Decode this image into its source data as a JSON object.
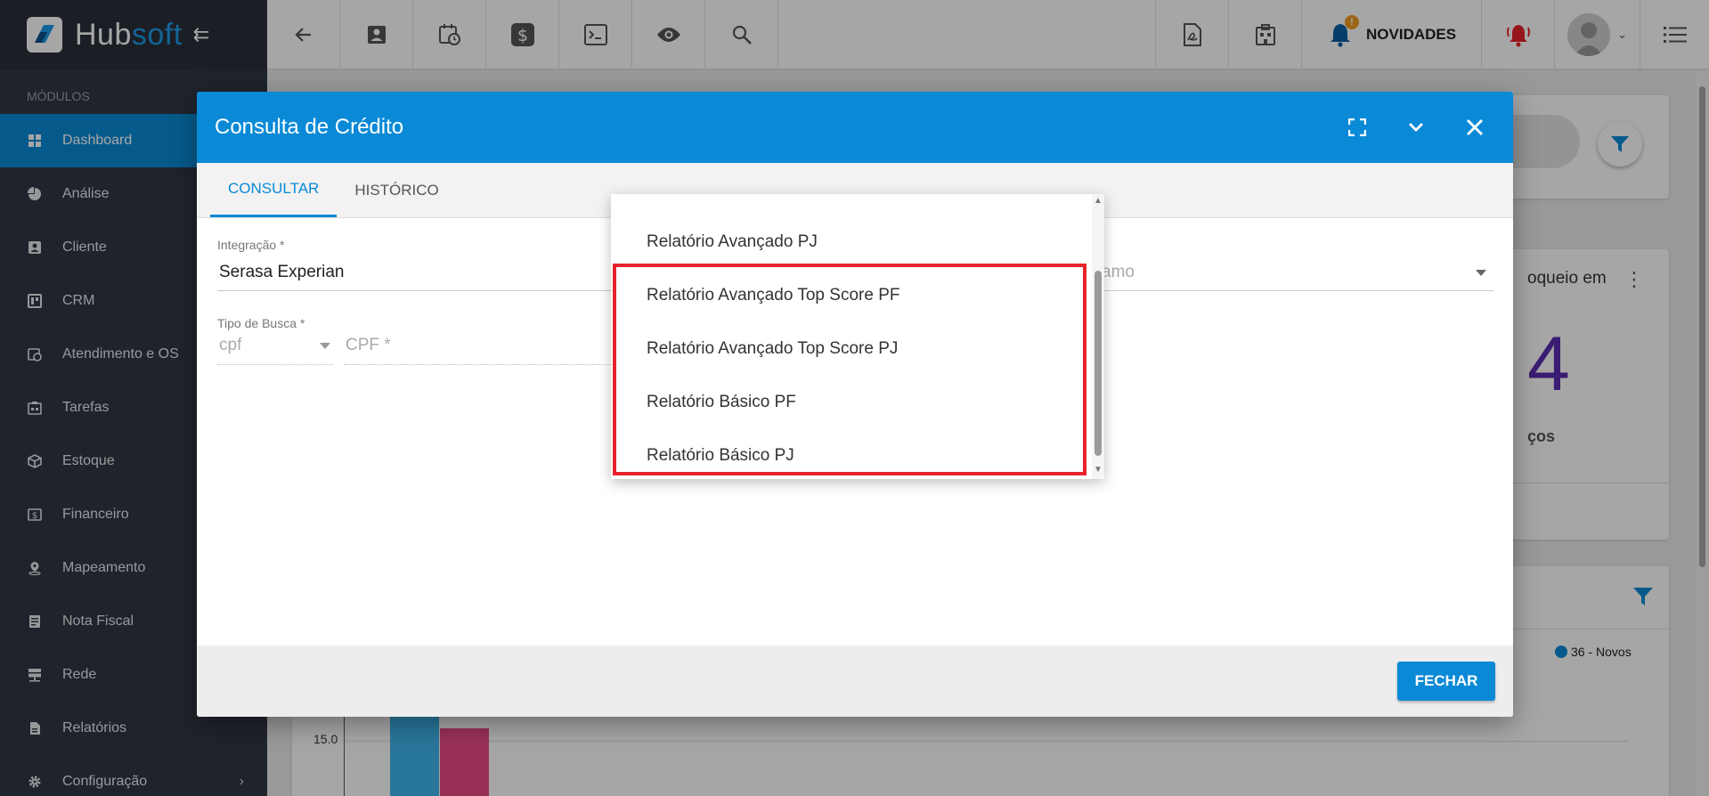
{
  "brand": {
    "name_a": "Hub",
    "name_b": "soft"
  },
  "sidebar": {
    "section_label": "MÓDULOS",
    "items": [
      {
        "label": "Dashboard",
        "icon": "dashboard-icon"
      },
      {
        "label": "Análise",
        "icon": "pie-chart-icon"
      },
      {
        "label": "Cliente",
        "icon": "contact-card-icon"
      },
      {
        "label": "CRM",
        "icon": "board-icon"
      },
      {
        "label": "Atendimento e OS",
        "icon": "calendar-clock-icon"
      },
      {
        "label": "Tarefas",
        "icon": "tasks-icon"
      },
      {
        "label": "Estoque",
        "icon": "box-icon"
      },
      {
        "label": "Financeiro",
        "icon": "money-icon"
      },
      {
        "label": "Mapeamento",
        "icon": "map-pin-icon"
      },
      {
        "label": "Nota Fiscal",
        "icon": "document-icon"
      },
      {
        "label": "Rede",
        "icon": "server-icon"
      },
      {
        "label": "Relatórios",
        "icon": "report-icon"
      },
      {
        "label": "Configuração",
        "icon": "gear-icon"
      }
    ]
  },
  "topbar": {
    "novidades_label": "NOVIDADES",
    "badge": "!"
  },
  "background": {
    "card_partial_text": "oqueio em",
    "big_number": "4",
    "big_number_sub": "ços",
    "legend_label": "36 - Novos",
    "axis_tick": "15.0"
  },
  "dialog": {
    "title": "Consulta de Crédito",
    "tabs": [
      {
        "label": "CONSULTAR"
      },
      {
        "label": "HISTÓRICO"
      }
    ],
    "integracao_label": "Integração *",
    "integracao_value": "Serasa Experian",
    "third_field_partial": "amo",
    "tipo_busca_label": "Tipo de Busca *",
    "tipo_busca_value": "cpf",
    "cpf_placeholder": "CPF *",
    "close_button": "FECHAR"
  },
  "dropdown": {
    "items": [
      {
        "label": "Relatório Avançado PJ"
      },
      {
        "label": "Relatório Avançado Top Score PF"
      },
      {
        "label": "Relatório Avançado Top Score PJ"
      },
      {
        "label": "Relatório Básico PF"
      },
      {
        "label": "Relatório Básico PJ"
      }
    ]
  },
  "colors": {
    "primary": "#0a8ad6",
    "sidebar": "#303642",
    "highlight": "#e8232b"
  }
}
